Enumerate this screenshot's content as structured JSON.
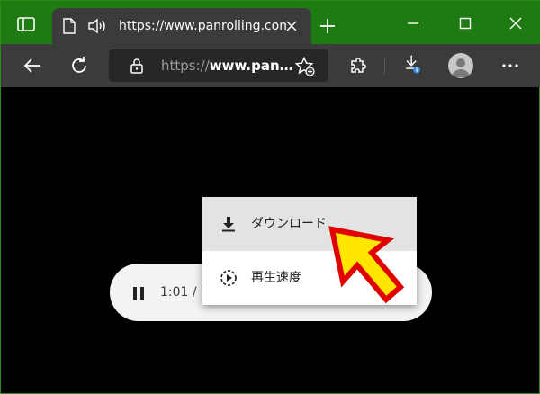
{
  "tab": {
    "title": "https://www.panrolling.com"
  },
  "address_bar": {
    "scheme": "https://",
    "host": "www.pan…"
  },
  "player": {
    "time": "1:01 /"
  },
  "context_menu": {
    "items": [
      {
        "label": "ダウンロード",
        "icon": "download-icon"
      },
      {
        "label": "再生速度",
        "icon": "playback-speed-icon"
      }
    ]
  },
  "colors": {
    "titlebar": "#1e7b12",
    "toolbar": "#3b3b3b",
    "arrow_fill": "#ffe600",
    "arrow_stroke": "#e00000"
  }
}
